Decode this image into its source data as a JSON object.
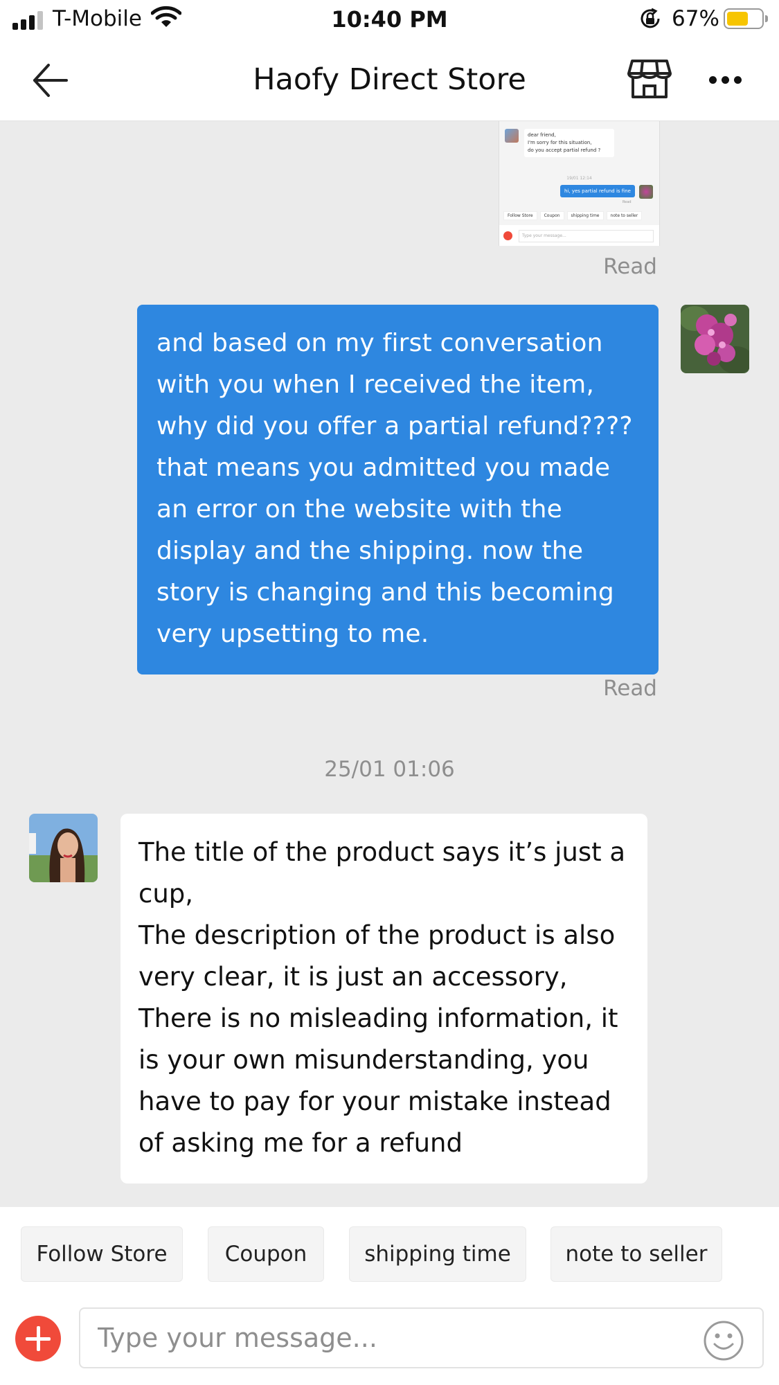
{
  "status_bar": {
    "carrier": "T-Mobile",
    "time": "10:40 PM",
    "battery_percent": "67%",
    "battery_level": 0.67,
    "icons": [
      "signal-icon",
      "wifi-icon",
      "orientation-lock-icon",
      "battery-icon"
    ]
  },
  "header": {
    "title": "Haofy Direct Store",
    "icons": [
      "back-arrow-icon",
      "store-icon",
      "more-icon"
    ]
  },
  "chat": {
    "screenshot_preview": {
      "incoming_text": "dear friend,\nI'm sorry for this situation,\ndo you accept partial refund ?",
      "timestamp": "19/01 12:14",
      "outgoing_text": "hi, yes partial refund is fine",
      "read": "Read",
      "quick_replies": [
        "Follow Store",
        "Coupon",
        "shipping time",
        "note to seller"
      ],
      "input_placeholder": "Type your message..."
    },
    "read_label_1": "Read",
    "outgoing_message": "and based on my first conversation with you when I received the item, why did you offer a partial refund???? that means you admitted you made an error on the website with the display and the shipping.  now the story is changing and this becoming very upsetting to me.",
    "read_label_2": "Read",
    "timestamp": "25/01 01:06",
    "incoming_message": {
      "lines": [
        "The title of the product says it’s just a cup,",
        "The description of the product is also very clear, it is just an accessory,",
        "There is no misleading information, it is your own misunderstanding, you have to pay for your mistake instead of asking me for a refund"
      ]
    }
  },
  "quick_replies": [
    "Follow Store",
    "Coupon",
    "shipping time",
    "note to seller"
  ],
  "composer": {
    "placeholder": "Type your message...",
    "value": "",
    "icons": [
      "plus-icon",
      "emoji-icon"
    ]
  }
}
